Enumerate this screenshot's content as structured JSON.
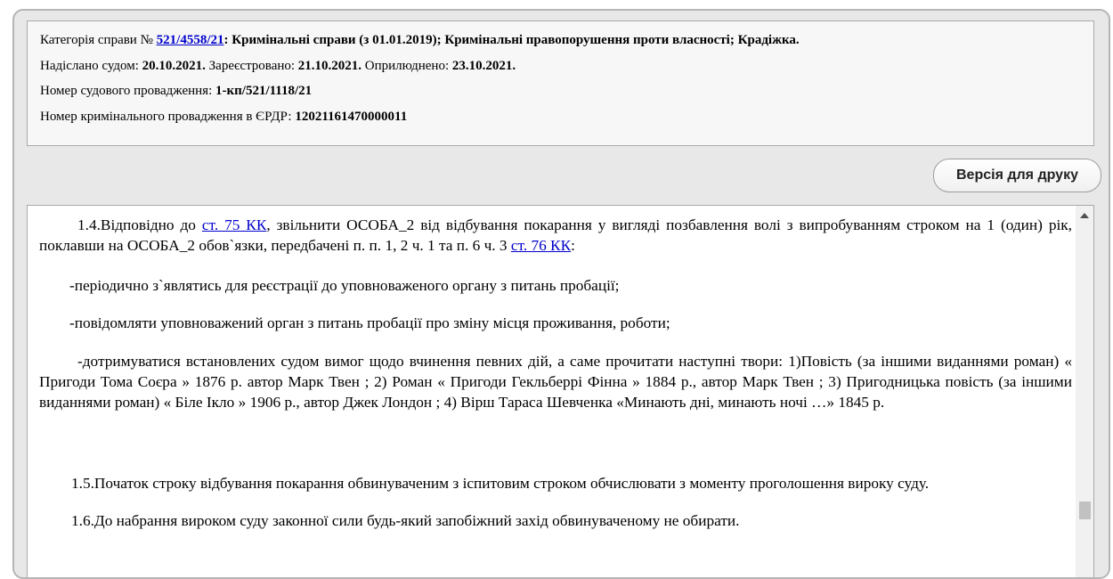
{
  "info": {
    "line1": {
      "prefix": "Категорія справи № ",
      "case_link": "521/4558/21",
      "rest": ": Кримінальні справи (з 01.01.2019); Кримінальні правопорушення проти власності; Крадіжка."
    },
    "line2": {
      "sent_label": "Надіслано судом: ",
      "sent_date": "20.10.2021.",
      "registered_label": " Зареєстровано: ",
      "registered_date": "21.10.2021.",
      "published_label": " Оприлюднено: ",
      "published_date": "23.10.2021."
    },
    "line3": {
      "label": "Номер судового провадження: ",
      "value": "1-кп/521/1118/21"
    },
    "line4": {
      "label": "Номер кримінального провадження в ЄРДР: ",
      "value": "12021161470000011"
    }
  },
  "toolbar": {
    "print_label": "Версія для друку"
  },
  "document": {
    "p1_a": "1.4.Відповідно до ",
    "p1_link1": "ст. 75 КК",
    "p1_b": ", звільнити ОСОБА_2 від відбування покарання у вигляді позбавлення волі з випробуванням строком на 1 (один) рік, поклавши на ОСОБА_2 обов`язки, передбачені п. п. 1, 2 ч. 1 та п. 6 ч. 3 ",
    "p1_link2": "ст. 76 КК",
    "p1_c": ":",
    "p2": "-періодично з`являтись для реєстрації до уповноваженого органу з питань пробації;",
    "p3": "-повідомляти уповноважений орган з питань пробації про зміну місця проживання, роботи;",
    "p4": " -дотримуватися встановлених судом вимог щодо вчинення певних дій, а саме прочитати наступні твори: 1)Повість (за іншими виданнями роман) « Пригоди Тома Соєра » 1876 р. автор Марк Твен ; 2) Роман « Пригоди Гекльберрі Фінна » 1884 р., автор Марк Твен ; 3) Пригодницька повість (за іншими виданнями роман) « Біле Ікло » 1906 р., автор Джек Лондон ; 4) Вірш Тараса Шевченка «Минають дні, минають ночі …» 1845 р.",
    "p5": "1.5.Початок строку відбування покарання обвинуваченим з іспитовим строком обчислювати з моменту проголошення вироку суду.",
    "p6": "1.6.До набрання вироком суду законної сили будь-який запобіжний захід обвинуваченому не обирати."
  }
}
